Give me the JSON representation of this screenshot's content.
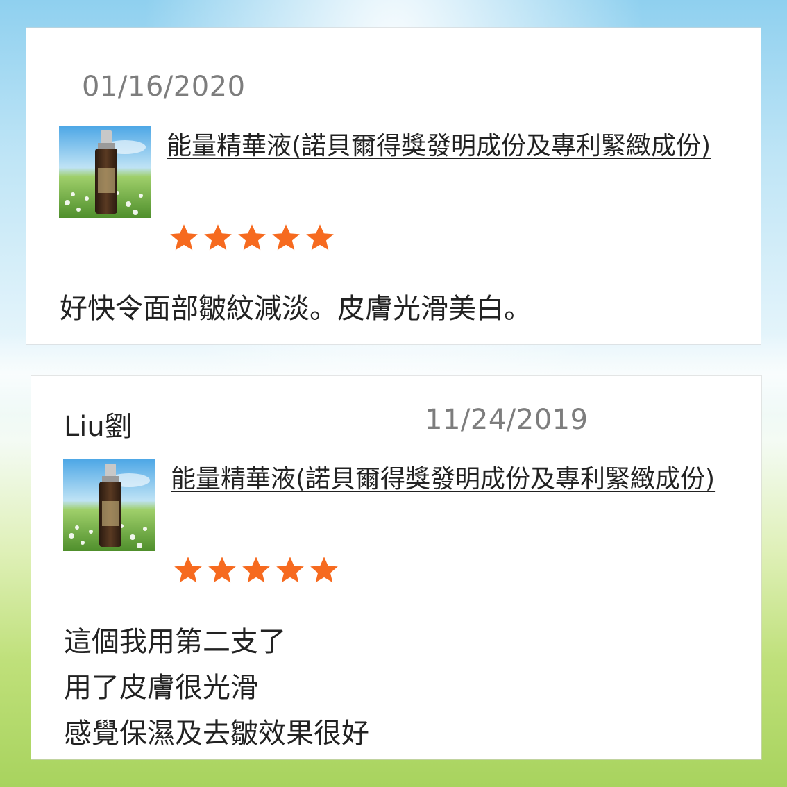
{
  "reviews": [
    {
      "date": "01/16/2020",
      "product_name": "能量精華液(諾貝爾得獎發明成份及專利緊緻成份)",
      "rating": 5,
      "comment_lines": [
        "好快令面部皺紋減淡。皮膚光滑美白。"
      ]
    },
    {
      "reviewer": "Liu劉",
      "date": "11/24/2019",
      "product_name": "能量精華液(諾貝爾得獎發明成份及專利緊緻成份)",
      "rating": 5,
      "comment_lines": [
        "這個我用第二支了",
        "用了皮膚很光滑",
        "感覺保濕及去皺效果很好"
      ]
    }
  ],
  "colors": {
    "star": "#f66a1f",
    "date": "#7d7d7d",
    "text": "#222222"
  },
  "icons": {
    "rating": "star-icon",
    "product": "product-thumbnail"
  }
}
